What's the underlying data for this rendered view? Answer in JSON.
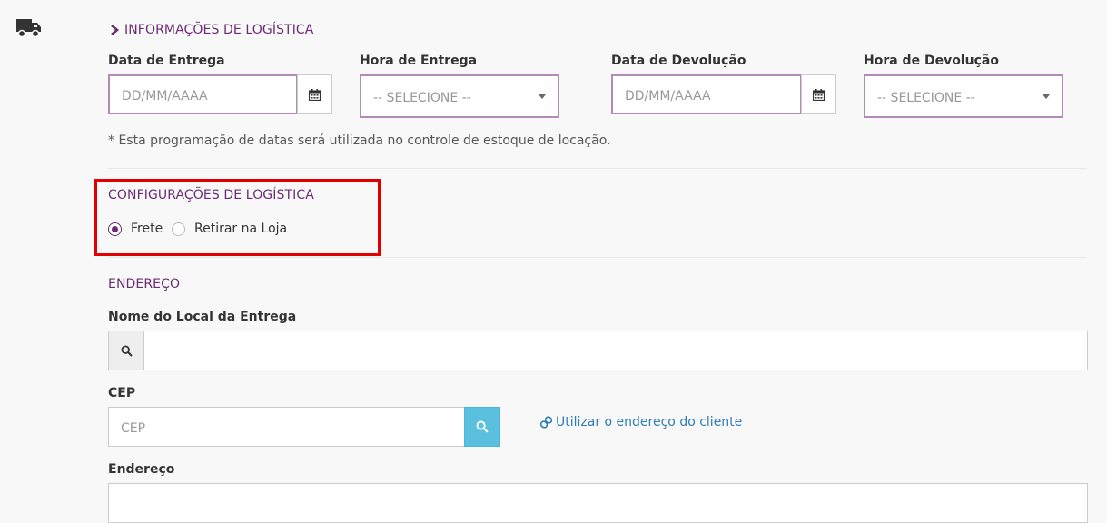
{
  "logistics_info": {
    "title": "INFORMAÇÕES DE LOGÍSTICA",
    "delivery_date": {
      "label": "Data de Entrega",
      "placeholder": "DD/MM/AAAA"
    },
    "delivery_time": {
      "label": "Hora de Entrega",
      "selected": "-- SELECIONE --"
    },
    "return_date": {
      "label": "Data de Devolução",
      "placeholder": "DD/MM/AAAA"
    },
    "return_time": {
      "label": "Hora de Devolução",
      "selected": "-- SELECIONE --"
    },
    "note": "* Esta programação de datas será utilizada no controle de estoque de locação."
  },
  "logistics_config": {
    "title": "CONFIGURAÇÕES DE LOGÍSTICA",
    "options": [
      {
        "label": "Frete",
        "checked": true
      },
      {
        "label": "Retirar na Loja",
        "checked": false
      }
    ]
  },
  "address": {
    "title": "ENDEREÇO",
    "location_name_label": "Nome do Local da Entrega",
    "cep_label": "CEP",
    "cep_placeholder": "CEP",
    "use_client_address_link": "Utilizar o endereço do cliente",
    "address_label": "Endereço"
  },
  "icons": {
    "truck": "truck-icon",
    "calendar": "calendar-icon",
    "search": "search-icon",
    "chevron": "chevron-right-icon",
    "link": "link-icon"
  },
  "colors": {
    "accent": "#6b2b73",
    "input_border": "#b48ab9",
    "search_button": "#5bc0de",
    "highlight": "#e00000",
    "link": "#2d7db3"
  }
}
